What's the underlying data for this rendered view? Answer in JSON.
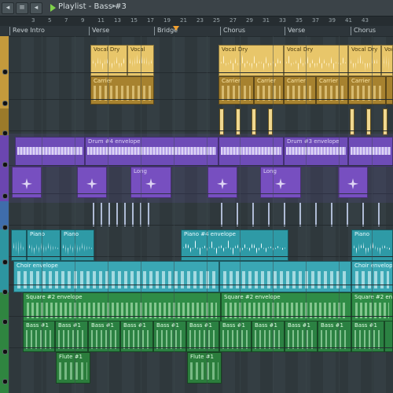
{
  "window": {
    "title": "Playlist - Bass #3",
    "title_arrow": "▸",
    "left_buttons": [
      "◂",
      "≡",
      "◂"
    ]
  },
  "ruler": {
    "ticks": [
      "3",
      "5",
      "7",
      "9",
      "11",
      "13",
      "15",
      "17",
      "19",
      "21",
      "23",
      "25",
      "27",
      "29",
      "31",
      "33",
      "35",
      "37",
      "39",
      "41",
      "43"
    ]
  },
  "markers": [
    {
      "label": "Reve Intro"
    },
    {
      "label": "Verse"
    },
    {
      "label": "Bridge"
    },
    {
      "label": "Chorus"
    },
    {
      "label": "Verse"
    },
    {
      "label": "Chorus"
    }
  ],
  "clips": {
    "vocal_dry_a": "Vocal Dry",
    "vocal_dry_b": "Vocal",
    "vocal_dry_c": "Vocal Dry",
    "vocal_dry_d": "Vocal Dry",
    "vocal_dry_e": "Vocal Dry",
    "vocal_dry_f": "Voca",
    "carrier": "Carrier",
    "drum4_env": "Drum #4 envelope",
    "drum3_env": "Drum #3 envelope",
    "long": "Long",
    "piano": "Piano",
    "piano4_env": "Piano #4 envelope",
    "choir_env": "Choir envelope",
    "square2_env": "Square #2 envelope",
    "bass1": "Bass #1",
    "flute1": "Flute #1"
  },
  "colors": {
    "vocal": "#e8c66a",
    "carrier": "#a7822f",
    "envelope": "#6f4bb8",
    "piano": "#2e9aa6",
    "square": "#2f8c46",
    "bass": "#2b8142"
  }
}
